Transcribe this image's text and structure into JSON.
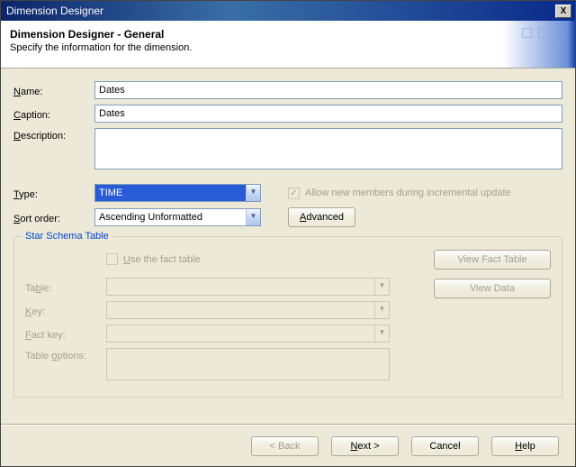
{
  "window": {
    "title": "Dimension Designer"
  },
  "header": {
    "title": "Dimension Designer - General",
    "subtitle": "Specify the information for the dimension."
  },
  "fields": {
    "name": {
      "label": "Name:",
      "value": "Dates"
    },
    "caption": {
      "label": "Caption:",
      "value": "Dates"
    },
    "description": {
      "label": "Description:",
      "value": ""
    },
    "type": {
      "label": "Type:",
      "value": "TIME"
    },
    "sort_order": {
      "label": "Sort order:",
      "value": "Ascending Unformatted"
    },
    "allow_new": {
      "label": "Allow new members during incremental update",
      "checked": true
    },
    "advanced": "Advanced"
  },
  "group": {
    "title": "Star Schema Table",
    "use_fact": {
      "label": "Use the fact table",
      "checked": false
    },
    "table": {
      "label": "Table:",
      "value": ""
    },
    "key": {
      "label": "Key:",
      "value": ""
    },
    "fact_key": {
      "label": "Fact key:",
      "value": ""
    },
    "table_options": {
      "label": "Table options:",
      "value": ""
    },
    "view_fact": "View Fact Table",
    "view_data": "View Data"
  },
  "footer": {
    "back": "< Back",
    "next": "Next >",
    "cancel": "Cancel",
    "help": "Help"
  }
}
